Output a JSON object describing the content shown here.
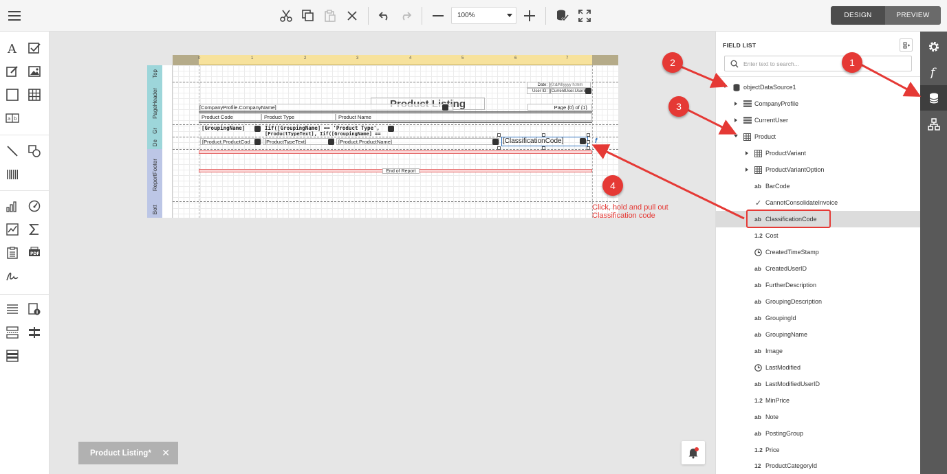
{
  "toolbar": {
    "zoom_value": "100%",
    "design_label": "DESIGN",
    "preview_label": "PREVIEW"
  },
  "report": {
    "bands": [
      "Top",
      "PageHeader",
      "Gr",
      "De",
      "ReportFooter",
      "Bott"
    ],
    "ruler_numbers": [
      "0",
      "1",
      "2",
      "3",
      "4",
      "5",
      "6",
      "7"
    ],
    "title": "Product Listing",
    "date_label": "Date:",
    "date_value": "{0:d/M/yyyy h:mm",
    "userid_label": "User ID:",
    "userid_value": "[CurrentUser.UserId]",
    "company_field": "[CompanyProfile.CompanyName]",
    "page_field": "Page {0} of {1}",
    "col_product_code": "Product Code",
    "col_product_type": "Product Type",
    "col_product_name": "Product Name",
    "grouping_name": "[GroupingName]",
    "grouping_expr": "Iif([GroupingName] == 'Product Type',",
    "grouping_expr2": "[ProductTypeText], Iif([GroupingName] ==",
    "detail_code": "[Product.ProductCod",
    "detail_type": "[ProductTypeText]",
    "detail_name": "[Product.ProductName]",
    "detail_classification": "[ClassificationCode]",
    "footer_text": "End of Report",
    "fx_label": "f"
  },
  "document_tab": {
    "label": "Product Listing*",
    "close_glyph": "✕"
  },
  "field_list": {
    "title": "FIELD LIST",
    "search_placeholder": "Enter text to search...",
    "root": "objectDataSource1",
    "items": [
      {
        "label": "CompanyProfile",
        "icon": "ab"
      },
      {
        "label": "CurrentUser",
        "icon": "ab"
      },
      {
        "label": "Product",
        "icon": "ab"
      },
      {
        "label": "ProductVariant",
        "icon": "ab"
      },
      {
        "label": "ProductVariantOption",
        "icon": "ab"
      },
      {
        "label": "BarCode",
        "icon": "ab"
      },
      {
        "label": "CannotConsolidateInvoice",
        "icon": "✓"
      },
      {
        "label": "ClassificationCode",
        "icon": "ab"
      },
      {
        "label": "Cost",
        "icon": "1.2"
      },
      {
        "label": "CreatedTimeStamp",
        "icon": "ab"
      },
      {
        "label": "CreatedUserID",
        "icon": "ab"
      },
      {
        "label": "FurtherDescription",
        "icon": "ab"
      },
      {
        "label": "GroupingDescription",
        "icon": "ab"
      },
      {
        "label": "GroupingId",
        "icon": "ab"
      },
      {
        "label": "GroupingName",
        "icon": "ab"
      },
      {
        "label": "Image",
        "icon": "ab"
      },
      {
        "label": "LastModified",
        "icon": "ab"
      },
      {
        "label": "LastModifiedUserID",
        "icon": "ab"
      },
      {
        "label": "MinPrice",
        "icon": "1.2"
      },
      {
        "label": "Note",
        "icon": "ab"
      },
      {
        "label": "PostingGroup",
        "icon": "ab"
      },
      {
        "label": "Price",
        "icon": "1.2"
      },
      {
        "label": "ProductCategoryId",
        "icon": "12"
      }
    ]
  },
  "annotations": {
    "badge1": "1",
    "badge2": "2",
    "badge3": "3",
    "badge4": "4",
    "instruction_line1": "Click, hold and pull out",
    "instruction_line2": "Classification code"
  },
  "colors": {
    "annotation_red": "#e53935",
    "selection_blue": "#2a6ebb",
    "rail_bg": "#595959",
    "ruler_yellow": "#f7e29c"
  }
}
